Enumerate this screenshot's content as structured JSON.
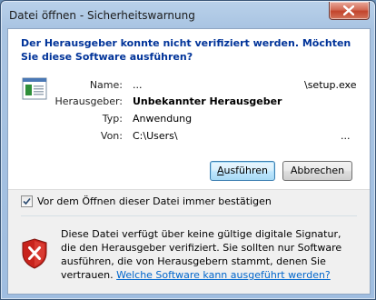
{
  "window": {
    "title": "Datei öffnen - Sicherheitswarnung"
  },
  "dialog": {
    "heading": "Der Herausgeber konnte nicht verifiziert werden. Möchten Sie diese Software ausführen?",
    "fields": [
      {
        "label": "Name:",
        "prefix": "...",
        "value": "\\setup.exe"
      },
      {
        "label": "Herausgeber:",
        "value": "Unbekannter Herausgeber"
      },
      {
        "label": "Typ:",
        "value": "Anwendung"
      },
      {
        "label": "Von:",
        "value": "C:\\Users\\",
        "suffix": "..."
      }
    ],
    "run_button": "Ausführen",
    "run_button_accel": "A",
    "run_button_rest": "usführen",
    "cancel_button": "Abbrechen",
    "checkbox": {
      "label": "Vor dem Öffnen dieser Datei immer bestätigen",
      "checked": true
    },
    "warning": {
      "text": "Diese Datei verfügt über keine gültige digitale Signatur, die den Herausgeber verifiziert. Sie sollten nur Software ausführen, die von Herausgebern stammt, denen Sie vertrauen.",
      "link": "Welche Software kann ausgeführt werden?"
    }
  },
  "icons": {
    "close": "close-icon",
    "application": "application-icon",
    "shield": "security-shield-icon",
    "checkmark": "checkmark-icon"
  },
  "colors": {
    "heading": "#003399",
    "link": "#0066cc",
    "shield_red": "#c8231c",
    "close_button": "#c2442c"
  }
}
